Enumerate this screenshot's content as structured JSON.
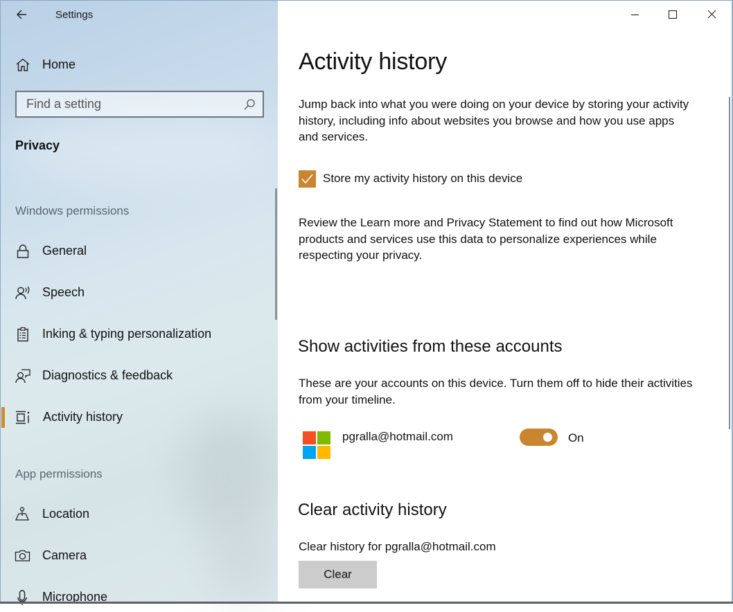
{
  "window": {
    "title": "Settings",
    "controls": {
      "minimize": "minimize",
      "maximize": "maximize",
      "close": "close"
    }
  },
  "sidebar": {
    "home_label": "Home",
    "search_placeholder": "Find a setting",
    "section_title": "Privacy",
    "groups": [
      {
        "label": "Windows permissions",
        "items": [
          {
            "label": "General",
            "icon": "lock-icon"
          },
          {
            "label": "Speech",
            "icon": "speech-icon"
          },
          {
            "label": "Inking & typing personalization",
            "icon": "clipboard-icon"
          },
          {
            "label": "Diagnostics & feedback",
            "icon": "feedback-icon"
          },
          {
            "label": "Activity history",
            "icon": "activity-history-icon",
            "active": true
          }
        ]
      },
      {
        "label": "App permissions",
        "items": [
          {
            "label": "Location",
            "icon": "location-icon"
          },
          {
            "label": "Camera",
            "icon": "camera-icon"
          },
          {
            "label": "Microphone",
            "icon": "microphone-icon"
          }
        ]
      }
    ]
  },
  "main": {
    "title": "Activity history",
    "intro": "Jump back into what you were doing on your device by storing your activity history, including info about websites you browse and how you use apps and services.",
    "store_checkbox": {
      "label": "Store my activity history on this device",
      "checked": true
    },
    "review_text": "Review the Learn more and Privacy Statement to find out how Microsoft products and services use this data to personalize experiences while respecting your privacy.",
    "accounts_section": {
      "heading": "Show activities from these accounts",
      "description": "These are your accounts on this device. Turn them off to hide their activities from your timeline.",
      "accounts": [
        {
          "email": "pgralla@hotmail.com",
          "toggle_on": true,
          "state_label": "On"
        }
      ]
    },
    "clear_section": {
      "heading": "Clear activity history",
      "description": "Clear history for pgralla@hotmail.com",
      "button_label": "Clear"
    }
  },
  "colors": {
    "accent": "#c9852f",
    "nav_accent": "#d18a2c",
    "ms_red": "#f25022",
    "ms_green": "#7fba00",
    "ms_blue": "#00a4ef",
    "ms_yellow": "#ffb900",
    "button_gray": "#cccccc"
  }
}
